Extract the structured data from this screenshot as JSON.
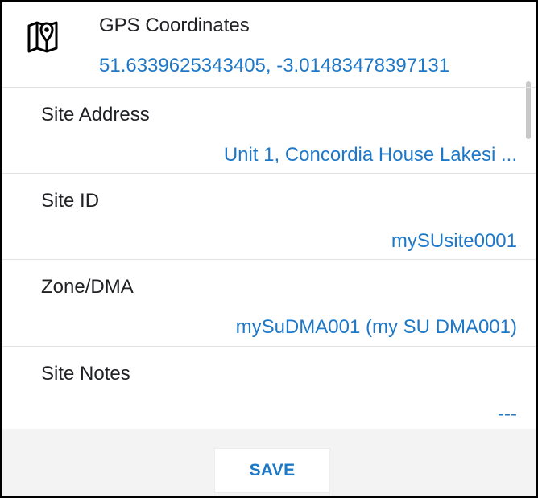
{
  "gps": {
    "icon": "map-pin-icon",
    "label": "GPS Coordinates",
    "value": "51.6339625343405, -3.01483478397131"
  },
  "fields": [
    {
      "label": "Site Address",
      "value": "Unit 1, Concordia House Lakesi ..."
    },
    {
      "label": "Site ID",
      "value": "mySUsite0001"
    },
    {
      "label": "Zone/DMA",
      "value": "mySuDMA001 (my SU DMA001)"
    },
    {
      "label": "Site Notes",
      "value": "---"
    }
  ],
  "actions": {
    "save_label": "SAVE"
  },
  "colors": {
    "accent": "#1e78c8",
    "text": "#202124",
    "divider": "#e2e2e2",
    "footer_background": "#f3f3f3",
    "frame_border": "#000000"
  }
}
